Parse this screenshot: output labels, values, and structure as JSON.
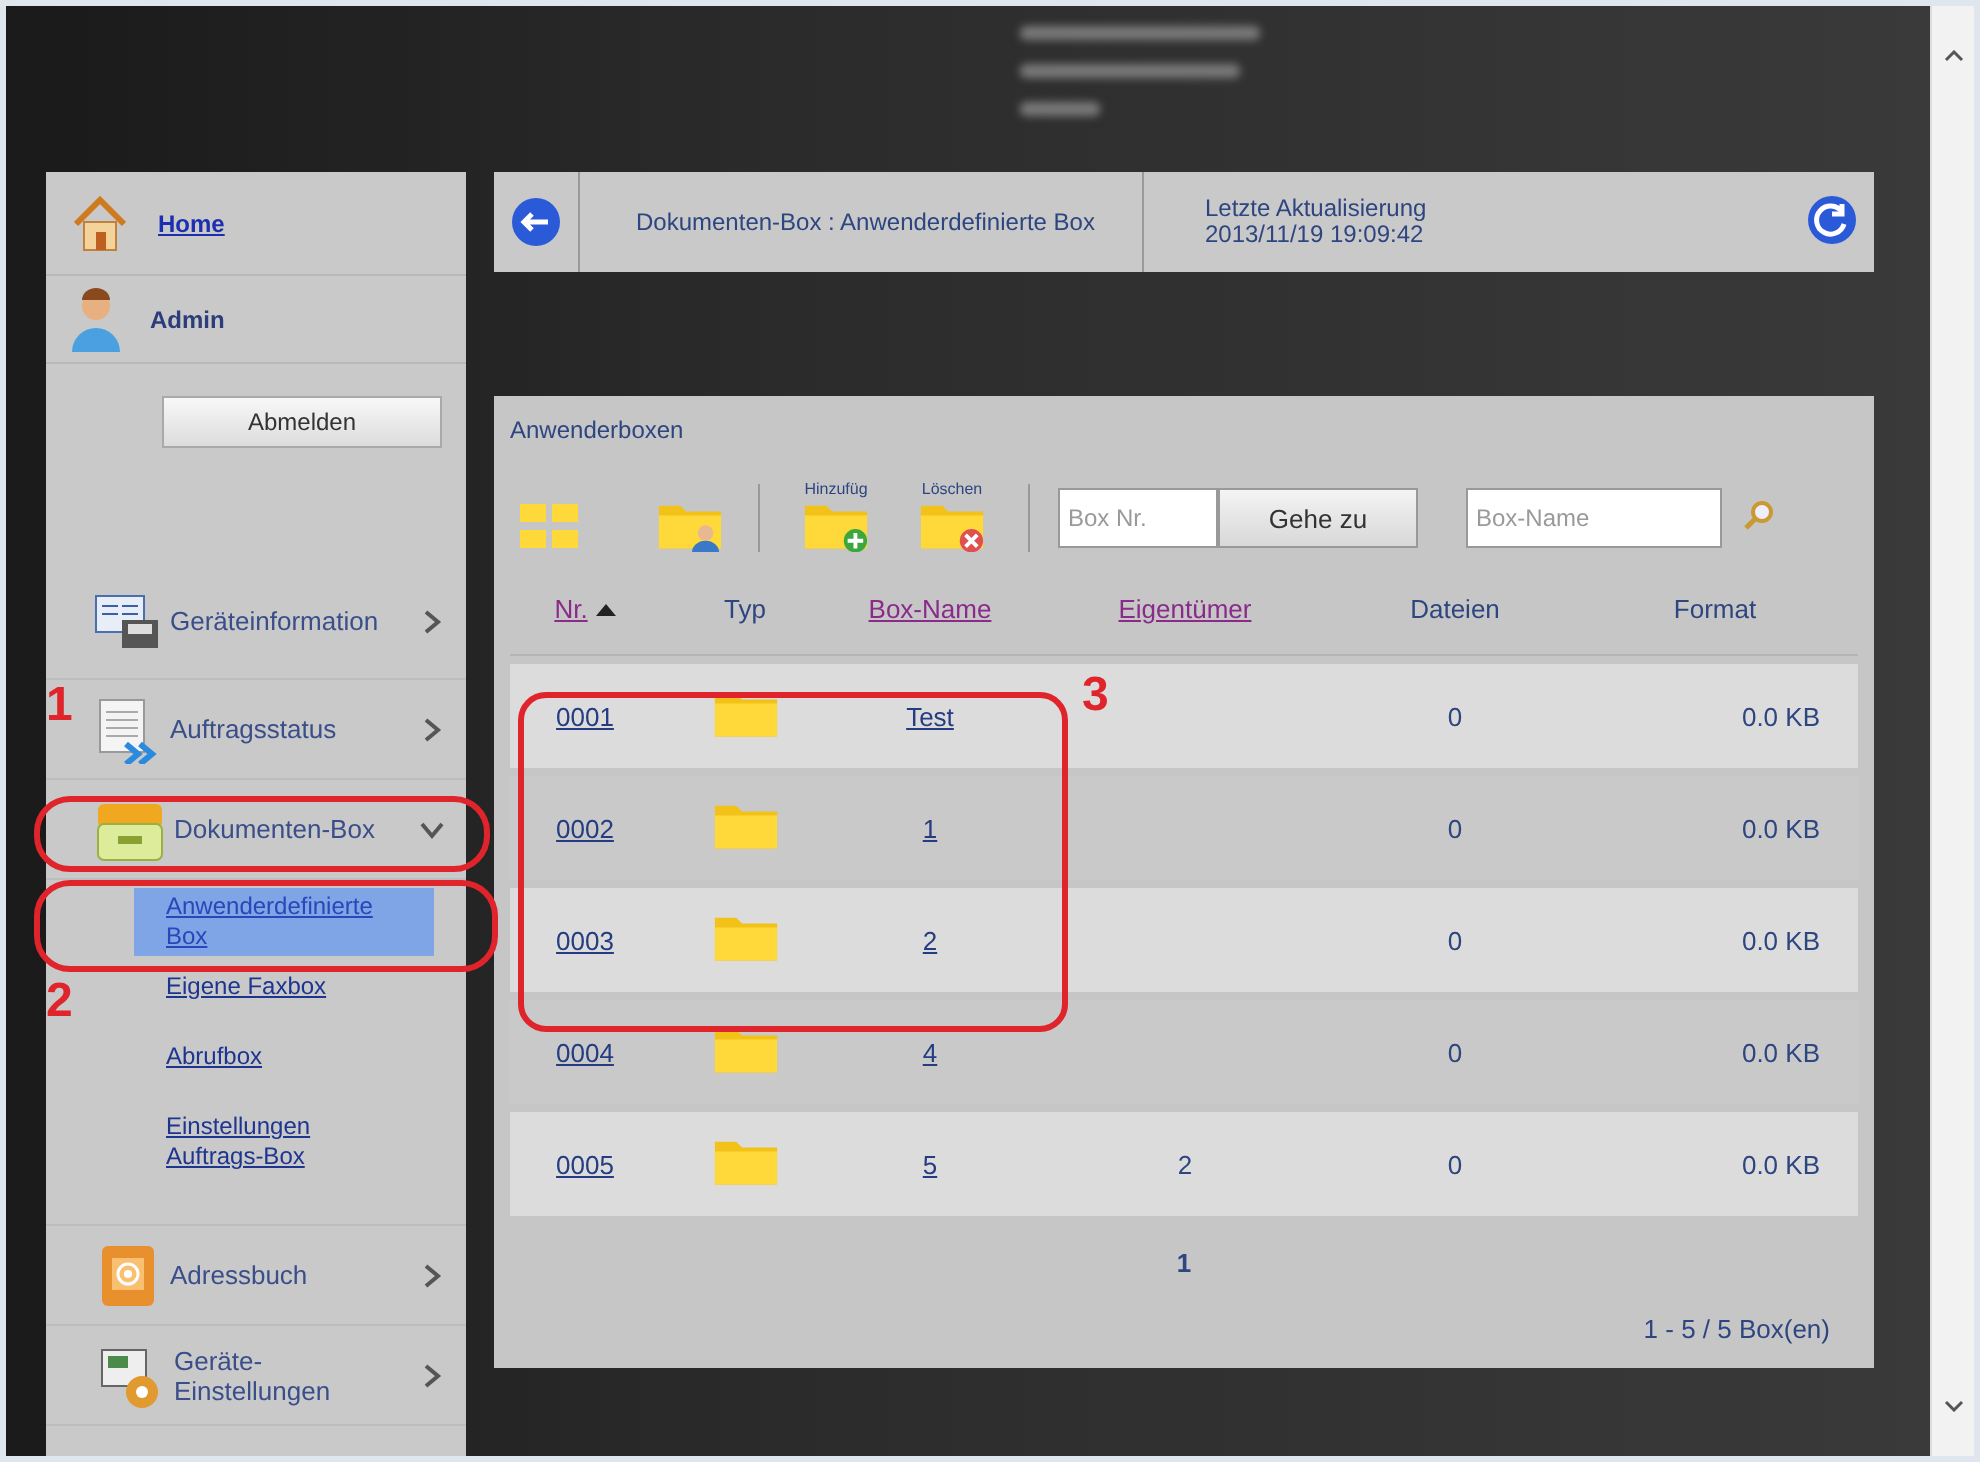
{
  "sidebar": {
    "home": "Home",
    "user": "Admin",
    "logout_button": "Abmelden",
    "menu": [
      {
        "kind": "info",
        "label": "Geräteinformation",
        "expanded": false
      },
      {
        "kind": "jobs",
        "label": "Auftragsstatus",
        "expanded": false
      },
      {
        "kind": "box",
        "label": "Dokumenten-Box",
        "expanded": true,
        "children": [
          {
            "label": "Anwenderdefinierte Box",
            "selected": true
          },
          {
            "label": "Eigene Faxbox",
            "selected": false
          },
          {
            "label": "Abrufbox",
            "selected": false
          },
          {
            "label": "Einstellungen Auftrags-Box",
            "selected": false
          }
        ]
      },
      {
        "kind": "address",
        "label": "Adressbuch",
        "expanded": false
      },
      {
        "kind": "settings",
        "label": "Geräte-Einstellungen",
        "expanded": false
      }
    ]
  },
  "header": {
    "breadcrumb": "Dokumenten-Box : Anwenderdefinierte Box",
    "updated_label": "Letzte Aktualisierung",
    "updated_time": "2013/11/19 19:09:42"
  },
  "panel": {
    "title": "Anwenderboxen",
    "toolbar": {
      "add_label": "Hinzufüg",
      "delete_label": "Löschen",
      "box_nr_placeholder": "Box Nr.",
      "go_button": "Gehe zu",
      "box_name_placeholder": "Box-Name"
    },
    "table": {
      "columns": [
        {
          "label": "Nr.",
          "link": true,
          "sorted": true
        },
        {
          "label": "Typ",
          "link": false,
          "sorted": false
        },
        {
          "label": "Box-Name",
          "link": true,
          "sorted": false
        },
        {
          "label": "Eigentümer",
          "link": true,
          "sorted": false
        },
        {
          "label": "Dateien",
          "link": false,
          "sorted": false
        },
        {
          "label": "Format",
          "link": false,
          "sorted": false
        }
      ],
      "rows": [
        {
          "nr": "0001",
          "name": "Test",
          "files": "0",
          "format": "0.0 KB"
        },
        {
          "nr": "0002",
          "name": "1",
          "files": "0",
          "format": "0.0 KB"
        },
        {
          "nr": "0003",
          "name": "2",
          "files": "0",
          "format": "0.0 KB"
        },
        {
          "nr": "0004",
          "name": "4",
          "files": "0",
          "format": "0.0 KB"
        },
        {
          "nr": "0005",
          "name": "5",
          "owner": "2",
          "files": "0",
          "format": "0.0 KB"
        }
      ],
      "pagination": "1",
      "count": "1 - 5 / 5 Box(en)"
    }
  },
  "annotations": [
    {
      "label": "1"
    },
    {
      "label": "2"
    },
    {
      "label": "3"
    }
  ]
}
